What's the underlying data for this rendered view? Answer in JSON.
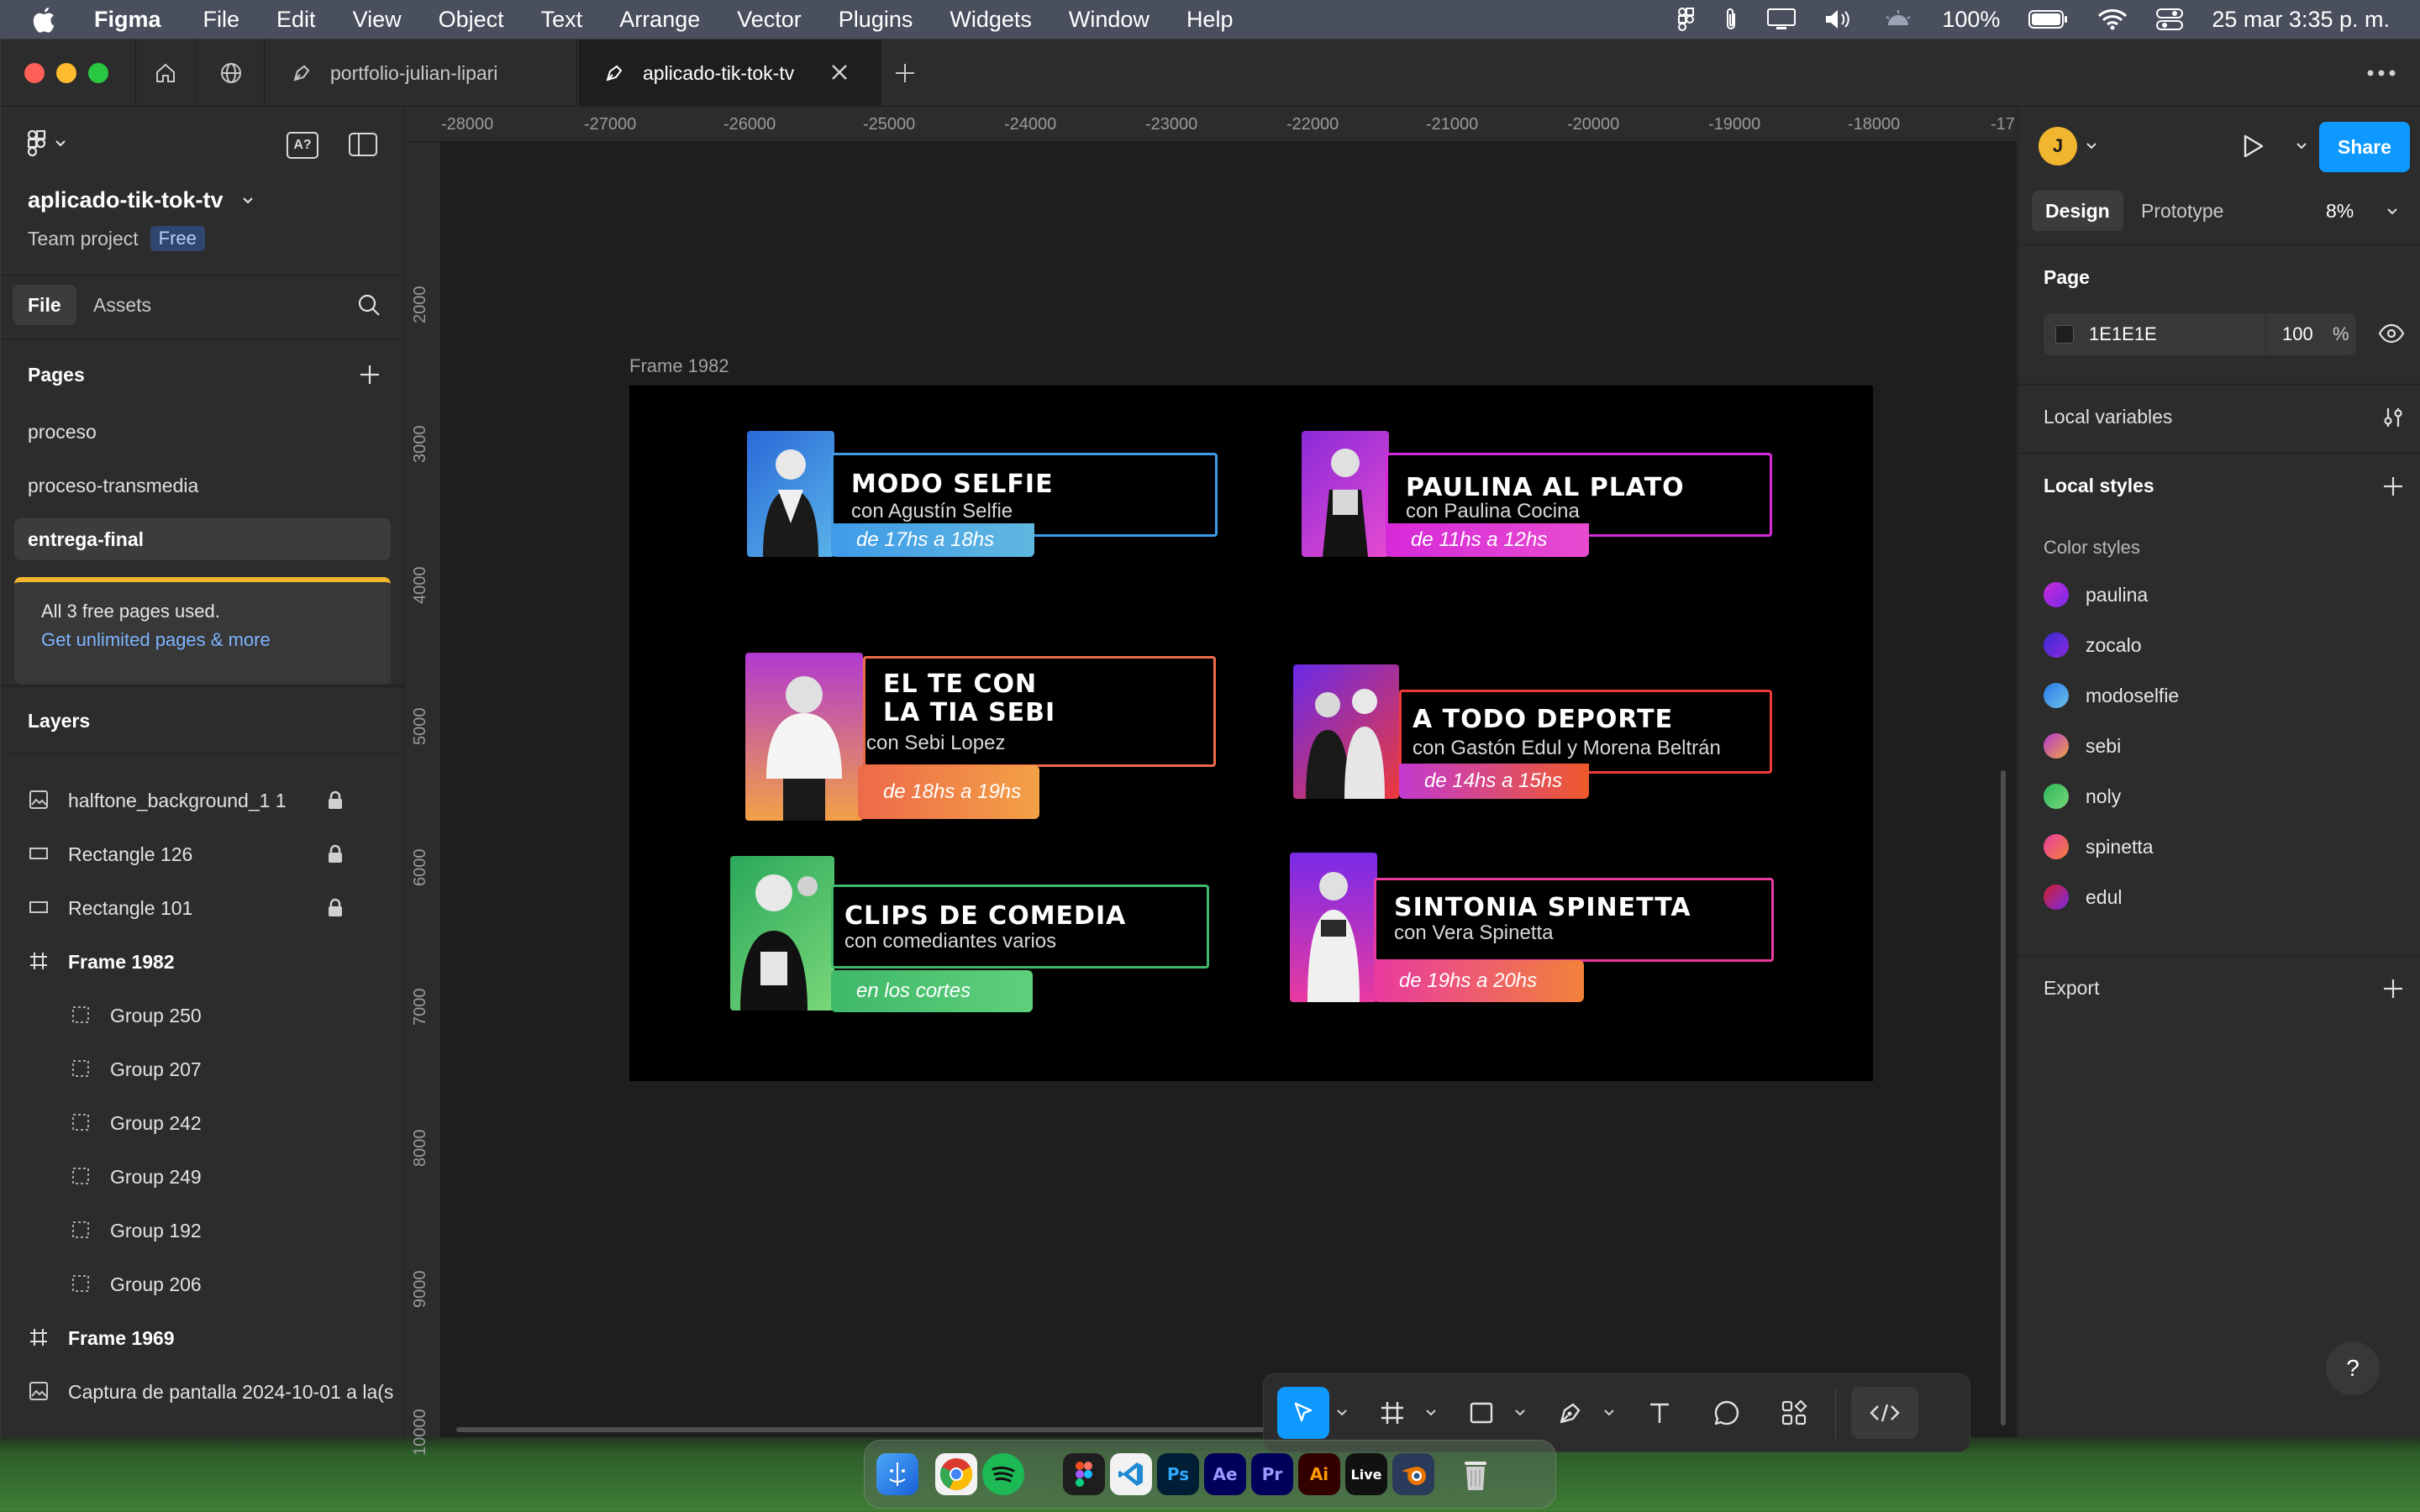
{
  "menubar": {
    "app_name": "Figma",
    "items": [
      "File",
      "Edit",
      "View",
      "Object",
      "Text",
      "Arrange",
      "Vector",
      "Plugins",
      "Widgets",
      "Window",
      "Help"
    ],
    "battery": "100%",
    "datetime": "25 mar  3:35 p. m."
  },
  "tabs": {
    "tab1": "portfolio-julian-lipari",
    "tab2": "aplicado-tik-tok-tv"
  },
  "left": {
    "file_name": "aplicado-tik-tok-tv",
    "team": "Team project",
    "plan_badge": "Free",
    "tab_file": "File",
    "tab_assets": "Assets",
    "pages_title": "Pages",
    "pages": [
      "proceso",
      "proceso-transmedia",
      "entrega-final"
    ],
    "notice_text": "All 3 free pages used.",
    "notice_link": "Get unlimited pages & more",
    "layers_title": "Layers",
    "layers": [
      "halftone_background_1 1",
      "Rectangle 126",
      "Rectangle 101",
      "Frame 1982",
      "Group 250",
      "Group 207",
      "Group 242",
      "Group 249",
      "Group 192",
      "Group 206",
      "Frame 1969",
      "Captura de pantalla 2024-10-01 a la(s"
    ]
  },
  "canvas": {
    "ruler_x": [
      "-28000",
      "-27000",
      "-26000",
      "-25000",
      "-24000",
      "-23000",
      "-22000",
      "-21000",
      "-20000",
      "-19000",
      "-18000",
      "-17"
    ],
    "ruler_y": [
      "2000",
      "3000",
      "4000",
      "5000",
      "6000",
      "7000",
      "8000",
      "9000",
      "10000"
    ],
    "frame_label": "Frame 1982",
    "cards": [
      {
        "title1": "MODO SELFIE",
        "title2": "",
        "sub": "con Agustín Selfie",
        "time": "de 17hs a 18hs",
        "color": "#3f9be8",
        "color2": "#5fb8e0"
      },
      {
        "title1": "PAULINA AL PLATO",
        "title2": "",
        "sub": "con Paulina Cocina",
        "time": "de 11hs a 12hs",
        "color": "#d62ad9",
        "color2": "#e84bd0"
      },
      {
        "title1": "EL TE CON",
        "title2": "LA TIA SEBI",
        "sub": "con Sebi Lopez",
        "time": "de 18hs a 19hs",
        "color": "#ee6a4a",
        "color2": "#f2a146"
      },
      {
        "title1": "A TODO DEPORTE",
        "title2": "",
        "sub": "con Gastón Edul y Morena Beltrán",
        "time": "de 14hs a 15hs",
        "color": "#ee3a3a",
        "color2": "#ef5a2a"
      },
      {
        "title1": "CLIPS DE COMEDIA",
        "title2": "",
        "sub": "con comediantes varios",
        "time": "en los cortes",
        "color": "#3fb86a",
        "color2": "#5fd07a"
      },
      {
        "title1": "SINTONIA SPINETTA",
        "title2": "",
        "sub": "con Vera Spinetta",
        "time": "de 19hs a 20hs",
        "color": "#e93aa0",
        "color2": "#f2823a"
      }
    ]
  },
  "right": {
    "avatar_letter": "J",
    "share": "Share",
    "tab_design": "Design",
    "tab_prototype": "Prototype",
    "zoom": "8%",
    "page_title": "Page",
    "page_color": "1E1E1E",
    "page_opacity": "100",
    "percent": "%",
    "local_variables": "Local variables",
    "local_styles": "Local styles",
    "color_styles_title": "Color styles",
    "color_styles": [
      {
        "name": "paulina",
        "c1": "#c62ad9",
        "c2": "#7a2ae8"
      },
      {
        "name": "zocalo",
        "c1": "#3a2ad9",
        "c2": "#8a2ad9"
      },
      {
        "name": "modoselfie",
        "c1": "#2a7ae8",
        "c2": "#6ac0e8"
      },
      {
        "name": "sebi",
        "c1": "#b03ad0",
        "c2": "#f2a146"
      },
      {
        "name": "noly",
        "c1": "#2ab85a",
        "c2": "#7ad87a"
      },
      {
        "name": "spinetta",
        "c1": "#e93aa0",
        "c2": "#f2823a"
      },
      {
        "name": "edul",
        "c1": "#d0202a",
        "c2": "#7a2ae8"
      }
    ],
    "export": "Export",
    "help": "?"
  },
  "dock": {
    "apps": [
      "Finder",
      "Chrome",
      "Spotify",
      "Figma",
      "VS Code",
      "Ps",
      "Ae",
      "Pr",
      "Ai",
      "Live",
      "Blender",
      "Trash"
    ]
  }
}
